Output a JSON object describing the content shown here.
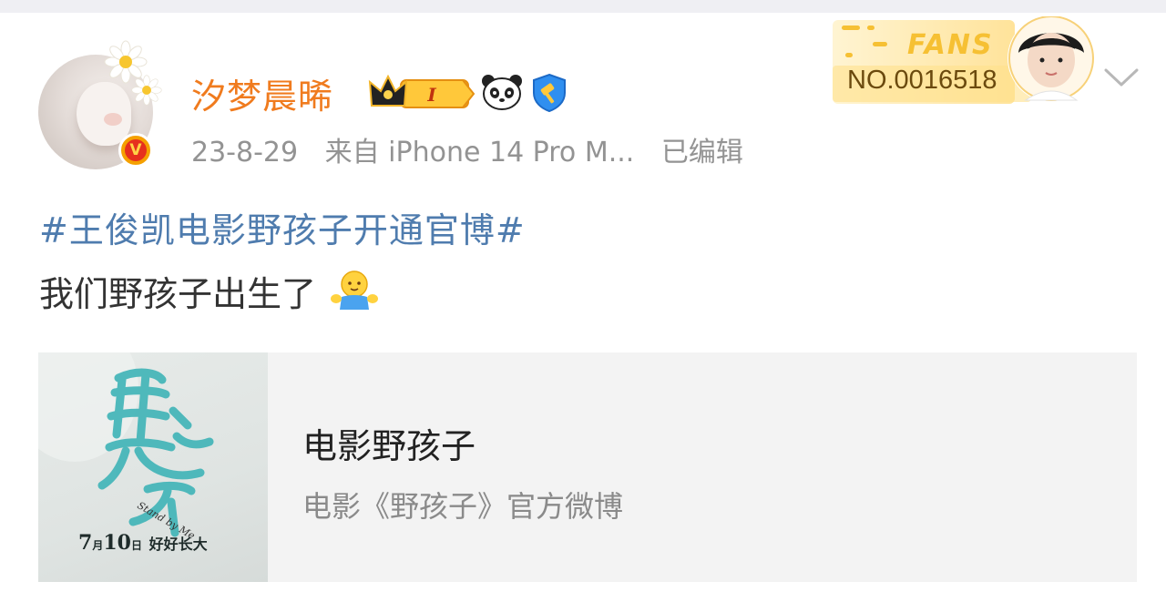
{
  "post": {
    "username": "汐梦晨晞",
    "date": "23-8-29",
    "source": "来自 iPhone 14 Pro M...",
    "edited": "已编辑",
    "hashtag": "#王俊凯电影野孩子开通官博#",
    "content": "我们野孩子出生了",
    "level_badge": "I",
    "verified_badge": "V"
  },
  "fans_badge": {
    "label": "FANS",
    "number": "NO.0016518"
  },
  "card": {
    "title": "电影野孩子",
    "subtitle": "电影《野孩子》官方微博",
    "thumb_date_month": "7",
    "thumb_date_m_unit": "月",
    "thumb_date_day": "10",
    "thumb_date_d_unit": "日",
    "thumb_slogan": "好好长大",
    "thumb_calligraphy": "野孩子",
    "thumb_english": "Stand by Me"
  },
  "icons": {
    "crown": "crown-icon",
    "panda": "panda-icon",
    "shield": "shield-icon",
    "emoji": "hug-emoji-icon",
    "chevron": "chevron-down-icon"
  },
  "colors": {
    "username": "#f07b1e",
    "hashtag": "#4f7cae",
    "meta": "#939393",
    "fans_gold": "#f6c033"
  }
}
